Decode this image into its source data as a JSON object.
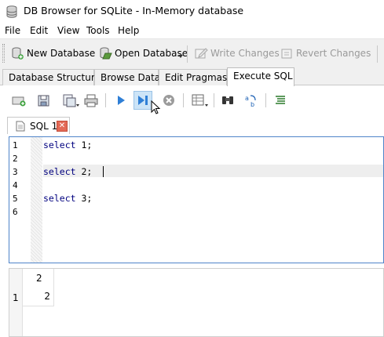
{
  "window": {
    "title": "DB Browser for SQLite - In-Memory database",
    "icon": "database-icon"
  },
  "menubar": {
    "items": [
      "File",
      "Edit",
      "View",
      "Tools",
      "Help"
    ]
  },
  "main_toolbar": {
    "new_database": "New Database",
    "open_database": "Open Database",
    "write_changes": "Write Changes",
    "revert_changes": "Revert Changes",
    "write_disabled": true,
    "revert_disabled": true
  },
  "tabs": {
    "items": [
      "Database Structure",
      "Browse Data",
      "Edit Pragmas",
      "Execute SQL"
    ],
    "active": "Execute SQL"
  },
  "sql_toolbar": {
    "icons": [
      "open-tab-icon",
      "open-sql-file-icon",
      "save-sql-file-icon",
      "save-results-icon",
      "print-icon",
      "execute-all-icon",
      "execute-current-line-icon",
      "stop-icon",
      "save-view-icon",
      "find-icon",
      "find-replace-icon",
      "comment-icon"
    ],
    "hovered": "execute-current-line-icon"
  },
  "editor": {
    "tab_label": "SQL 1",
    "line_numbers": [
      "1",
      "2",
      "3",
      "4",
      "5",
      "6"
    ],
    "lines": [
      {
        "kw": "select",
        "rest": " 1;"
      },
      {
        "kw": "",
        "rest": ""
      },
      {
        "kw": "select",
        "rest": " 2;"
      },
      {
        "kw": "",
        "rest": ""
      },
      {
        "kw": "select",
        "rest": " 3;"
      },
      {
        "kw": "",
        "rest": ""
      }
    ],
    "current_line": 3,
    "keyword_color": "#00007f"
  },
  "results": {
    "column_header": "2",
    "row_header": "1",
    "cell_value": "2"
  }
}
